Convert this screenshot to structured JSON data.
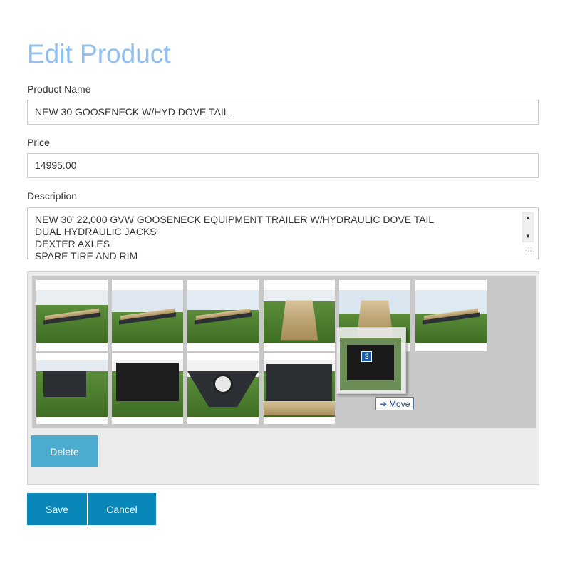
{
  "page": {
    "title": "Edit Product"
  },
  "form": {
    "product_name_label": "Product Name",
    "product_name_value": "NEW 30 GOOSENECK W/HYD DOVE TAIL",
    "price_label": "Price",
    "price_value": "14995.00",
    "description_label": "Description",
    "description_value": "NEW 30' 22,000 GVW GOOSENECK EQUIPMENT TRAILER W/HYDRAULIC DOVE TAIL\nDUAL HYDRAULIC JACKS\nDEXTER AXLES\nSPARE TIRE AND RIM"
  },
  "gallery": {
    "images": [
      {
        "name": "trailer-photo-side"
      },
      {
        "name": "trailer-photo-front-angle"
      },
      {
        "name": "trailer-photo-rear-angle"
      },
      {
        "name": "trailer-photo-deck"
      },
      {
        "name": "trailer-photo-dovetail"
      },
      {
        "name": "trailer-photo-profile"
      },
      {
        "name": "trailer-photo-gooseneck"
      },
      {
        "name": "trailer-photo-toolbox"
      },
      {
        "name": "trailer-photo-spare-tire"
      },
      {
        "name": "trailer-photo-ramps"
      }
    ],
    "drag_count": "3",
    "drag_tooltip": "Move"
  },
  "buttons": {
    "delete": "Delete",
    "save": "Save",
    "cancel": "Cancel"
  },
  "colors": {
    "title": "#8ec0f4",
    "primary": "#0a87b9",
    "delete": "#4bacd0"
  },
  "icons": {
    "move_arrow": "arrow-right-icon",
    "scroll_up": "triangle-up-icon",
    "scroll_down": "triangle-down-icon"
  }
}
